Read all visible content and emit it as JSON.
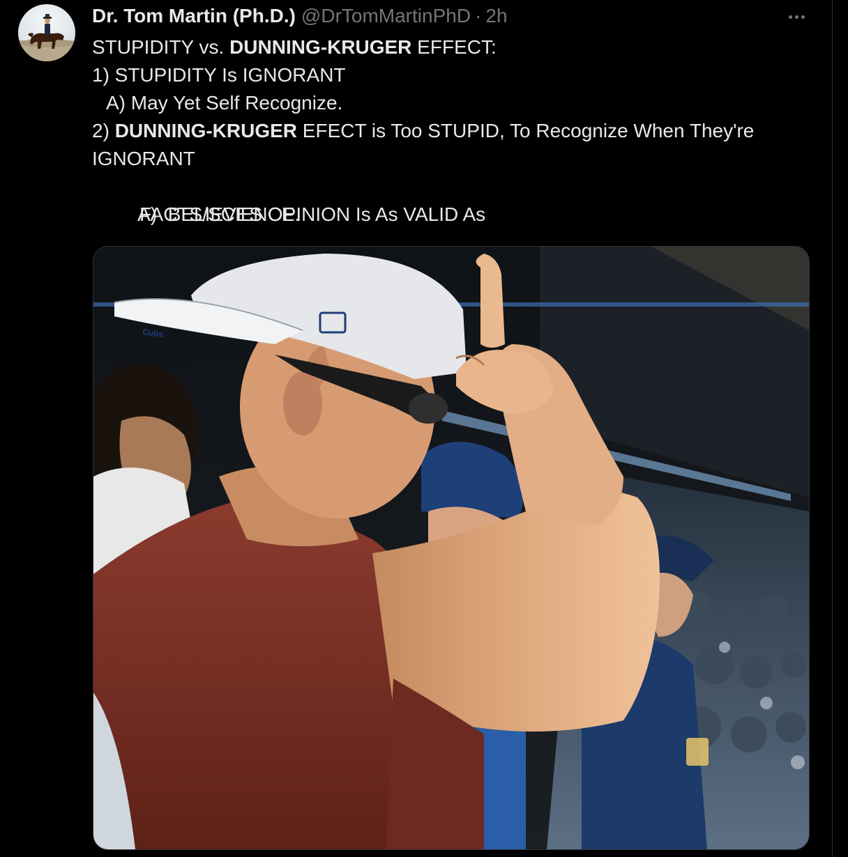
{
  "tweet": {
    "author": {
      "name": "Dr. Tom Martin (Ph.D.)",
      "handle": "@DrTomMartinPhD",
      "separator": "·",
      "time": "2h"
    },
    "more_icon": "more-horizontal-icon",
    "lines": [
      [
        {
          "text": "STUPIDITY vs. ",
          "bold": false
        },
        {
          "text": "DUNNING-KRUGER",
          "bold": true
        },
        {
          "text": " EFFECT:",
          "bold": false
        }
      ],
      [
        {
          "text": "1) STUPIDITY Is IGNORANT",
          "bold": false
        }
      ],
      [
        {
          "text": "A) May Yet Self Recognize.",
          "bold": false
        }
      ],
      [
        {
          "text": "2) ",
          "bold": false
        },
        {
          "text": "DUNNING-KRUGER",
          "bold": true
        },
        {
          "text": " EFECT is Too STUPID, To Recognize When They're",
          "bold": false
        }
      ],
      [
        {
          "text": "IGNORANT",
          "bold": false
        }
      ],
      [
        {
          "text": "A)  BELIEVES OPINION Is As VALID As",
          "bold": false
        }
      ],
      [
        {
          "text": "FACTS/SCIENCE.",
          "bold": false
        }
      ]
    ],
    "media": {
      "cap_logo": "Cubs"
    }
  },
  "colors": {
    "background": "#000000",
    "text": "#e7e9ea",
    "muted": "#71767b",
    "border": "#2f3336"
  }
}
